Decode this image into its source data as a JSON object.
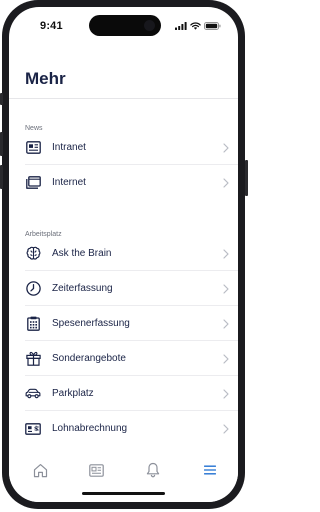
{
  "status_bar": {
    "time": "9:41"
  },
  "page": {
    "title": "Mehr"
  },
  "sections": [
    {
      "label": "News",
      "items": [
        {
          "label": "Intranet",
          "icon": "newspaper-icon"
        },
        {
          "label": "Internet",
          "icon": "browser-window-icon"
        }
      ]
    },
    {
      "label": "Arbeitsplatz",
      "items": [
        {
          "label": "Ask the Brain",
          "icon": "brain-icon"
        },
        {
          "label": "Zeiterfassung",
          "icon": "clock-icon"
        },
        {
          "label": "Spesenerfassung",
          "icon": "receipt-icon"
        },
        {
          "label": "Sonderangebote",
          "icon": "gift-icon"
        },
        {
          "label": "Parkplatz",
          "icon": "car-icon"
        },
        {
          "label": "Lohnabrechnung",
          "icon": "payslip-icon"
        }
      ]
    }
  ],
  "tab_bar": {
    "tabs": [
      {
        "icon": "home-icon",
        "active": false
      },
      {
        "icon": "newspaper-icon",
        "active": false
      },
      {
        "icon": "bell-icon",
        "active": false
      },
      {
        "icon": "menu-icon",
        "active": true
      }
    ]
  },
  "colors": {
    "primary_text": "#1a2346",
    "secondary_text": "#6b6f7a",
    "icon": "#1a2346",
    "active_tab": "#1f6fd1",
    "inactive_tab": "#8c909a",
    "chevron": "#b9bcc4",
    "divider": "#ececef"
  }
}
